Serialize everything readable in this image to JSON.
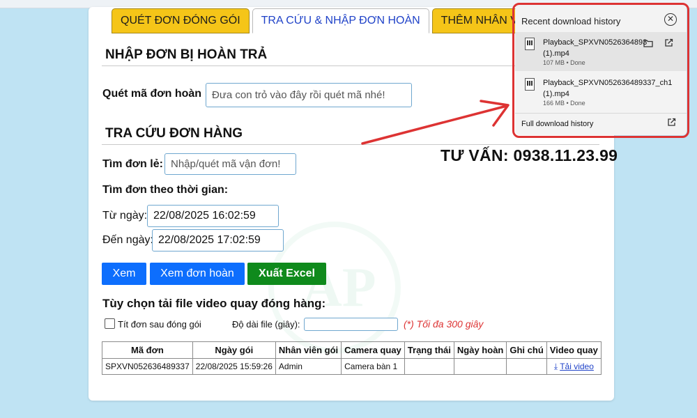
{
  "tabs": [
    {
      "label": "QUÉT ĐƠN ĐÓNG GÓI"
    },
    {
      "label": "TRA CỨU & NHẬP ĐƠN HOÀN"
    },
    {
      "label": "THÊM NHÂN VIÊN"
    }
  ],
  "return_section": {
    "title": "NHẬP ĐƠN BỊ HOÀN TRẢ",
    "scan_label": "Quét mã đơn hoàn",
    "scan_placeholder": "Đưa con trỏ vào đây rồi quét mã nhé!"
  },
  "lookup_section": {
    "title": "TRA CỨU ĐƠN HÀNG",
    "single_label": "Tìm đơn lẻ:",
    "single_placeholder": "Nhập/quét mã vận đơn!",
    "by_time_label": "Tìm đơn theo thời gian:",
    "from_label": "Từ ngày:",
    "from_value": "22/08/2025 16:02:59",
    "to_label": "Đến ngày:",
    "to_value": "22/08/2025 17:02:59",
    "btn_view": "Xem",
    "btn_view_returns": "Xem đơn hoàn",
    "btn_export": "Xuất Excel"
  },
  "download_options": {
    "title": "Tùy chọn tải file video quay đóng hàng:",
    "checkbox_label": "Tít đơn sau đóng gói",
    "duration_label": "Độ dài file (giây):",
    "duration_value": "",
    "max_note": "(*) Tối đa 300 giây"
  },
  "table": {
    "headers": [
      "Mã đơn",
      "Ngày gói",
      "Nhân viên gói",
      "Camera quay",
      "Trạng thái",
      "Ngày hoàn",
      "Ghi chú",
      "Video quay"
    ],
    "rows": [
      [
        "SPXVN052636489337",
        "22/08/2025 15:59:26",
        "Admin",
        "Camera bàn 1",
        "",
        "",
        "",
        "Tải video"
      ]
    ]
  },
  "consult": "TƯ VẤN: 0938.11.23.99",
  "download_popup": {
    "title": "Recent download history",
    "items": [
      {
        "name": "Playback_SPXVN0526364893 (1).mp4",
        "meta": "107 MB • Done"
      },
      {
        "name": "Playback_SPXVN052636489337_ch1 (1).mp4",
        "meta": "166 MB • Done"
      }
    ],
    "footer": "Full download history"
  },
  "colors": {
    "accent": "#d33333",
    "tab": "#f5c518",
    "button_blue": "#0d6efd",
    "button_green": "#0f8a1c"
  }
}
